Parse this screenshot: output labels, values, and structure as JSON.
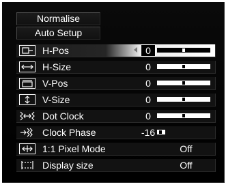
{
  "buttons": {
    "normalise": "Normalise",
    "auto_setup": "Auto Setup"
  },
  "items": [
    {
      "label": "H-Pos",
      "value": "0",
      "slider_fraction": 0.5,
      "icon": "h-pos-icon"
    },
    {
      "label": "H-Size",
      "value": "0",
      "slider_fraction": 0.5,
      "icon": "h-size-icon"
    },
    {
      "label": "V-Pos",
      "value": "0",
      "slider_fraction": 0.5,
      "icon": "v-pos-icon"
    },
    {
      "label": "V-Size",
      "value": "0",
      "slider_fraction": 0.5,
      "icon": "v-size-icon"
    },
    {
      "label": "Dot Clock",
      "value": "0",
      "slider_fraction": 0.5,
      "icon": "dot-clock-icon"
    },
    {
      "label": "Clock Phase",
      "value": "-16",
      "slider_fraction": 0.0,
      "icon": "clock-phase-icon"
    },
    {
      "label": "1:1 Pixel Mode",
      "value": "Off",
      "icon": "pixel-mode-icon"
    },
    {
      "label": "Display size",
      "value": "Off",
      "icon": "display-size-icon"
    }
  ],
  "selected_index": 0,
  "colors": {
    "menu_bg": "#000000",
    "text": "#ffffff",
    "highlight": "#ffffff"
  }
}
